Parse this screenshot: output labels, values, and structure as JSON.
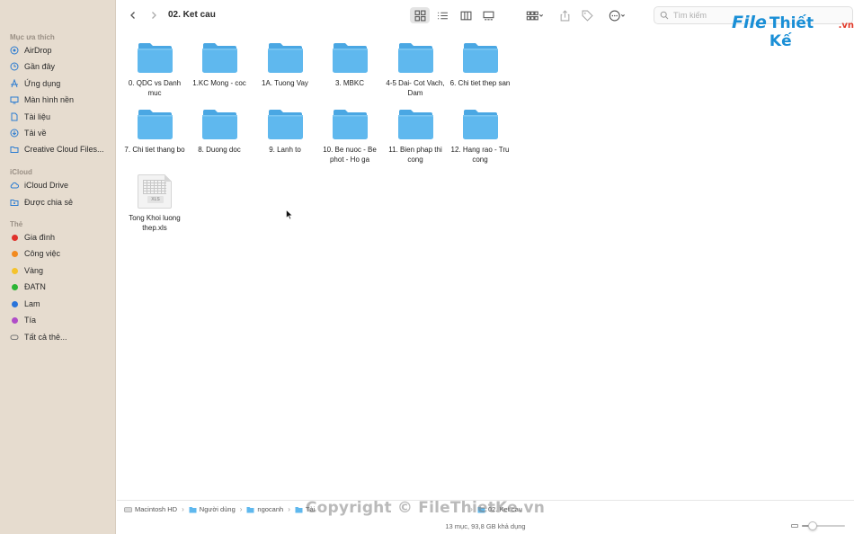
{
  "window": {
    "title": "02. Ket cau"
  },
  "sidebar": {
    "sections": [
      {
        "title": "Mục ưa thích",
        "items": [
          {
            "label": "AirDrop",
            "icon": "airdrop-icon"
          },
          {
            "label": "Gần đây",
            "icon": "clock-icon"
          },
          {
            "label": "Ứng dụng",
            "icon": "applications-icon"
          },
          {
            "label": "Màn hình nền",
            "icon": "desktop-icon"
          },
          {
            "label": "Tài liệu",
            "icon": "document-icon"
          },
          {
            "label": "Tải về",
            "icon": "download-icon"
          },
          {
            "label": "Creative Cloud Files...",
            "icon": "folder-icon"
          }
        ]
      },
      {
        "title": "iCloud",
        "items": [
          {
            "label": "iCloud Drive",
            "icon": "cloud-icon"
          },
          {
            "label": "Được chia sẻ",
            "icon": "shared-folder-icon"
          }
        ]
      },
      {
        "title": "Thẻ",
        "items": [
          {
            "label": "Gia đình",
            "color": "#e0312b"
          },
          {
            "label": "Công việc",
            "color": "#f28a1f"
          },
          {
            "label": "Vàng",
            "color": "#f5c32c"
          },
          {
            "label": "ĐATN",
            "color": "#2bb534"
          },
          {
            "label": "Lam",
            "color": "#2a74da"
          },
          {
            "label": "Tía",
            "color": "#b04dc8"
          },
          {
            "label": "Tất cả thẻ...",
            "icon": "all-tags-icon"
          }
        ]
      }
    ]
  },
  "toolbar": {
    "search_placeholder": "Tìm kiếm"
  },
  "watermark": {
    "logo_file": "File",
    "logo_thiet": "Thiết Kế",
    "logo_vn": ".vn",
    "copyright": "Copyright © FileThietKe.vn"
  },
  "files": [
    {
      "name": "0. QDC vs Danh muc",
      "type": "folder"
    },
    {
      "name": "1.KC Mong - coc",
      "type": "folder"
    },
    {
      "name": "1A. Tuong Vay",
      "type": "folder"
    },
    {
      "name": "3. MBKC",
      "type": "folder"
    },
    {
      "name": "4-5 Dai- Cot Vach, Dam",
      "type": "folder"
    },
    {
      "name": "6. Chi tiet thep san",
      "type": "folder"
    },
    {
      "name": "7. Chi tiet thang bo",
      "type": "folder"
    },
    {
      "name": "8. Duong doc",
      "type": "folder"
    },
    {
      "name": "9. Lanh to",
      "type": "folder"
    },
    {
      "name": "10. Be nuoc - Be phot - Ho ga",
      "type": "folder"
    },
    {
      "name": "11. Bien phap thi cong",
      "type": "folder"
    },
    {
      "name": "12. Hang rao - Tru cong",
      "type": "folder"
    },
    {
      "name": "Tong Khoi luong thep.xls",
      "type": "xls",
      "ext": "XLS"
    }
  ],
  "pathbar": {
    "crumbs": [
      "Macintosh HD",
      "Người dùng",
      "ngocanh",
      "Tài",
      "02. Ket cau"
    ]
  },
  "status": {
    "text": "13 mục, 93,8 GB khả dụng"
  },
  "zoom": {
    "level": 0.25
  },
  "colors": {
    "sidebar_bg": "#e6dccf",
    "folder_blue": "#5fb8ee",
    "folder_tab": "#4aa7e3",
    "accent": "#1a8fd6"
  }
}
